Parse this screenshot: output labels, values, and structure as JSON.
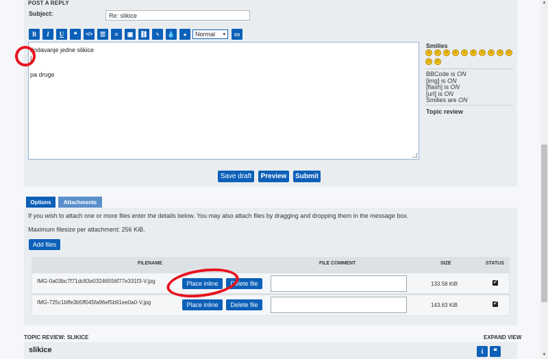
{
  "header": {
    "title": "POST A REPLY"
  },
  "subject": {
    "label": "Subject:",
    "value": "Re: slikice"
  },
  "toolbar": {
    "buttons": [
      {
        "label": "B",
        "name": "bold"
      },
      {
        "label": "I",
        "name": "italic"
      },
      {
        "label": "U",
        "name": "underline"
      },
      {
        "label": "❝",
        "name": "quote"
      },
      {
        "label": "</>",
        "name": "code"
      },
      {
        "label": "☰",
        "name": "list"
      },
      {
        "label": "≡",
        "name": "numbered-list"
      },
      {
        "label": "▣",
        "name": "image"
      },
      {
        "label": "⛓",
        "name": "link"
      },
      {
        "label": "ϟ",
        "name": "flash"
      },
      {
        "label": "💧",
        "name": "color"
      }
    ],
    "font_size": "Normal",
    "last_button": "▭"
  },
  "message": {
    "line1": "dodavanje jedne slikice",
    "line2": "|",
    "line3": "pa druge"
  },
  "sidebar": {
    "smilies_title": "Smilies",
    "smilies": [
      "☺",
      "☺",
      "☺",
      "☺",
      "☺",
      "☺",
      "☺",
      "☺",
      "☺",
      "☺",
      "☺",
      "☺"
    ],
    "bbcode": "BBCode is ",
    "bbcode_state": "ON",
    "img": "[img] is ",
    "img_state": "ON",
    "flash": "[flash] is ",
    "flash_state": "ON",
    "url": "[url] is ",
    "url_state": "ON",
    "smilies_status": "Smilies are ",
    "smilies_state": "ON",
    "topic_review": "Topic review"
  },
  "actions": {
    "save_draft": "Save draft",
    "preview": "Preview",
    "submit": "Submit"
  },
  "tabs": {
    "options": "Options",
    "attachments": "Attachments"
  },
  "attachments": {
    "intro": "If you wish to attach one or more files enter the details below. You may also attach files by dragging and dropping them in the message box.",
    "max_size": "Maximum filesize per attachment: 256 KiB.",
    "add_files": "Add files",
    "columns": {
      "filename": "FILENAME",
      "comment": "FILE COMMENT",
      "size": "SIZE",
      "status": "STATUS"
    },
    "rows": [
      {
        "filename": "IMG-0a03bc7f71dc83e03246556f77e331f3-V.jpg",
        "place_inline": "Place inline",
        "delete": "Delete file",
        "size": "133.58 KiB",
        "status": "✔"
      },
      {
        "filename": "IMG-725c1bffe3b5ff045fa96ef5b91ee0a0-V.jpg",
        "place_inline": "Place inline",
        "delete": "Delete file",
        "size": "143.63 KiB",
        "status": "✔"
      }
    ]
  },
  "review": {
    "header": "TOPIC REVIEW: SLIKICE",
    "expand": "EXPAND VIEW",
    "title": "slikice",
    "info_icon": "i",
    "quote_icon": "❝"
  },
  "colors": {
    "accent": "#0c60b8",
    "panel": "#eaedf0",
    "annotation": "#e8111d"
  }
}
